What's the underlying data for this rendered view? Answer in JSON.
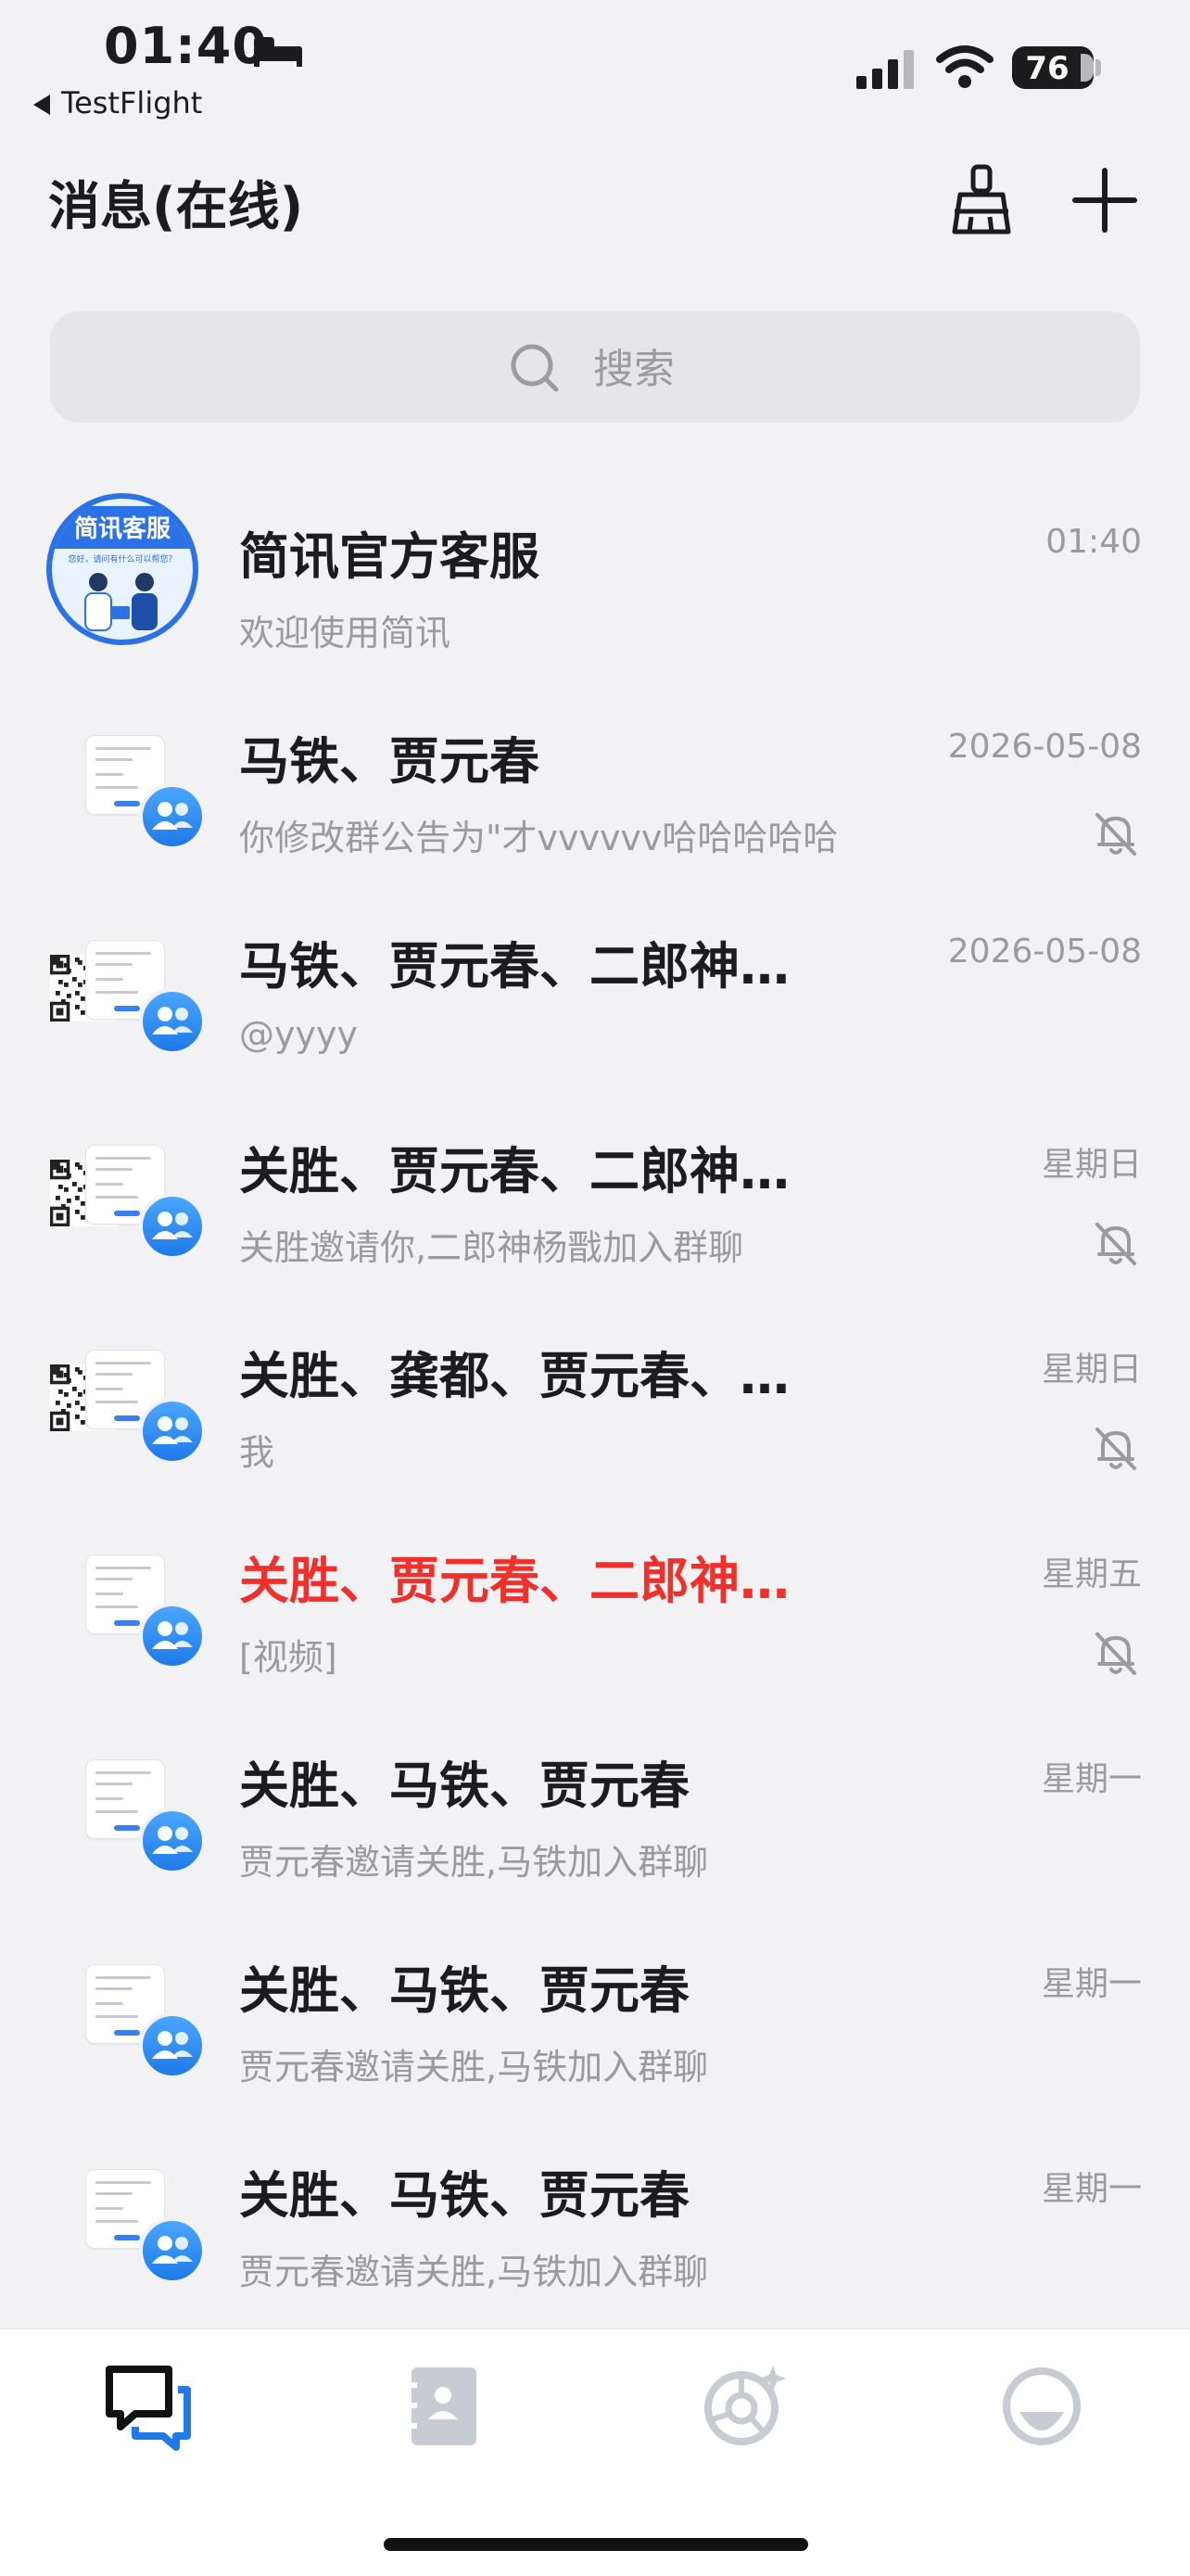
{
  "status_bar": {
    "time": "01:40",
    "back_app": "TestFlight",
    "battery": "76"
  },
  "header": {
    "title": "消息(在线)"
  },
  "search": {
    "placeholder": "搜索"
  },
  "conversations": [
    {
      "title": "简讯官方客服",
      "preview": "欢迎使用简讯",
      "time": "01:40",
      "muted": false,
      "title_color": "default",
      "avatar": "official-service-avatar",
      "avatar_text": "简讯客服",
      "avatar_subtext": "您好，请问有什么可以帮您？"
    },
    {
      "title": "马铁、贾元春",
      "preview": "你修改群公告为\"才vvvvvv哈哈哈哈哈",
      "time": "2026-05-08",
      "muted": true,
      "title_color": "default",
      "avatar": "group-avatar"
    },
    {
      "title": "马铁、贾元春、二郎神杨戬",
      "preview": "@yyyy",
      "time": "2026-05-08",
      "muted": false,
      "title_color": "default",
      "avatar": "group-qr-avatar"
    },
    {
      "title": "关胜、贾元春、二郎神杨戬",
      "preview": "关胜邀请你,二郎神杨戬加入群聊",
      "time": "星期日",
      "muted": true,
      "title_color": "default",
      "avatar": "group-qr-avatar"
    },
    {
      "title": "关胜、龚都、贾元春、二郎神",
      "preview": "我",
      "time": "星期日",
      "muted": true,
      "title_color": "default",
      "avatar": "group-qr-avatar"
    },
    {
      "title": "关胜、贾元春、二郎神杨戬",
      "preview": "[视频]",
      "time": "星期五",
      "muted": true,
      "title_color": "red",
      "avatar": "group-avatar"
    },
    {
      "title": "关胜、马铁、贾元春",
      "preview": "贾元春邀请关胜,马铁加入群聊",
      "time": "星期一",
      "muted": false,
      "title_color": "default",
      "avatar": "group-avatar"
    },
    {
      "title": "关胜、马铁、贾元春",
      "preview": "贾元春邀请关胜,马铁加入群聊",
      "time": "星期一",
      "muted": false,
      "title_color": "default",
      "avatar": "group-avatar"
    },
    {
      "title": "关胜、马铁、贾元春",
      "preview": "贾元春邀请关胜,马铁加入群聊",
      "time": "星期一",
      "muted": false,
      "title_color": "default",
      "avatar": "group-avatar"
    }
  ],
  "tabs": [
    {
      "name": "messages",
      "icon": "chat-bubbles-icon",
      "active": true
    },
    {
      "name": "contacts",
      "icon": "contacts-book-icon",
      "active": false
    },
    {
      "name": "discover",
      "icon": "camera-aperture-icon",
      "active": false
    },
    {
      "name": "me",
      "icon": "smiley-face-icon",
      "active": false
    }
  ],
  "colors": {
    "accent": "#1f7ae8",
    "unread_title": "#f0312b",
    "muted_text": "#9a9a9f",
    "background": "#f2f2f4"
  }
}
